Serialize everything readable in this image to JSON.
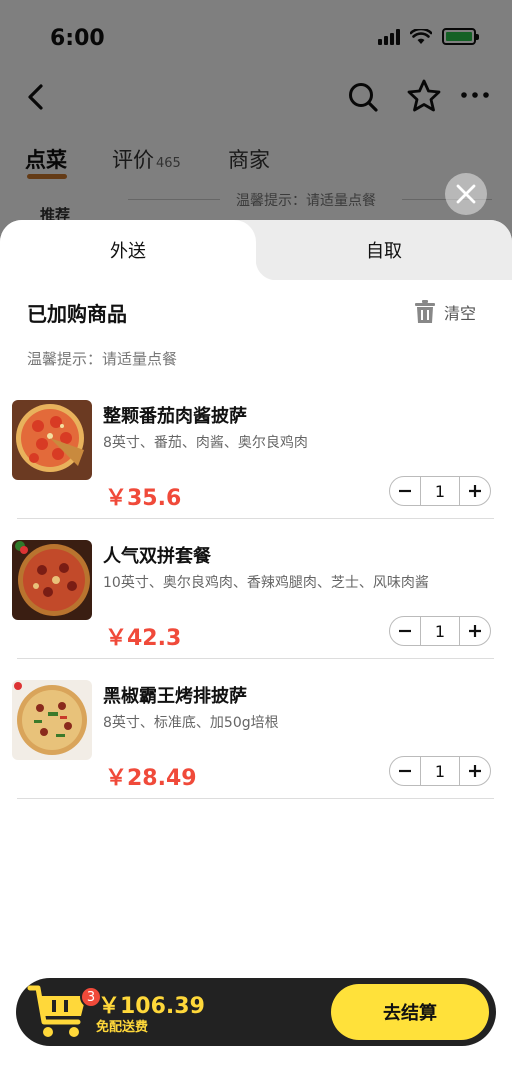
{
  "status_bar": {
    "time": "6:00"
  },
  "nav": {
    "back_icon": "chevron-left-icon",
    "search_icon": "search-icon",
    "favorite_icon": "star-icon",
    "more_icon": "more-icon"
  },
  "store_tabs": [
    {
      "label": "点菜",
      "active": true
    },
    {
      "label": "评价",
      "count": "465"
    },
    {
      "label": "商家"
    }
  ],
  "background_hint": "温馨提示：请适量点餐",
  "background_recommend": "推荐",
  "sheet": {
    "tabs": [
      {
        "label": "外送",
        "active": true
      },
      {
        "label": "自取",
        "active": false
      }
    ],
    "title": "已加购商品",
    "clear_label": "清空",
    "hint": "温馨提示：请适量点餐",
    "items": [
      {
        "name": "整颗番茄肉酱披萨",
        "desc": "8英寸、番茄、肉酱、奥尔良鸡肉",
        "price": "￥35.6",
        "qty": "1"
      },
      {
        "name": "人气双拼套餐",
        "desc": "10英寸、奥尔良鸡肉、香辣鸡腿肉、芝士、风味肉酱",
        "price": "￥42.3",
        "qty": "1"
      },
      {
        "name": "黑椒霸王烤排披萨",
        "desc": "8英寸、标准底、加50g培根",
        "price": "￥28.49",
        "qty": "1"
      }
    ]
  },
  "checkout": {
    "badge": "3",
    "total": "￥106.39",
    "delivery": "免配送费",
    "button": "去结算"
  },
  "colors": {
    "accent_yellow": "#ffe13a",
    "price_red": "#f04a3a",
    "bar_dark": "#222222",
    "tab_underline": "#c9762c"
  }
}
